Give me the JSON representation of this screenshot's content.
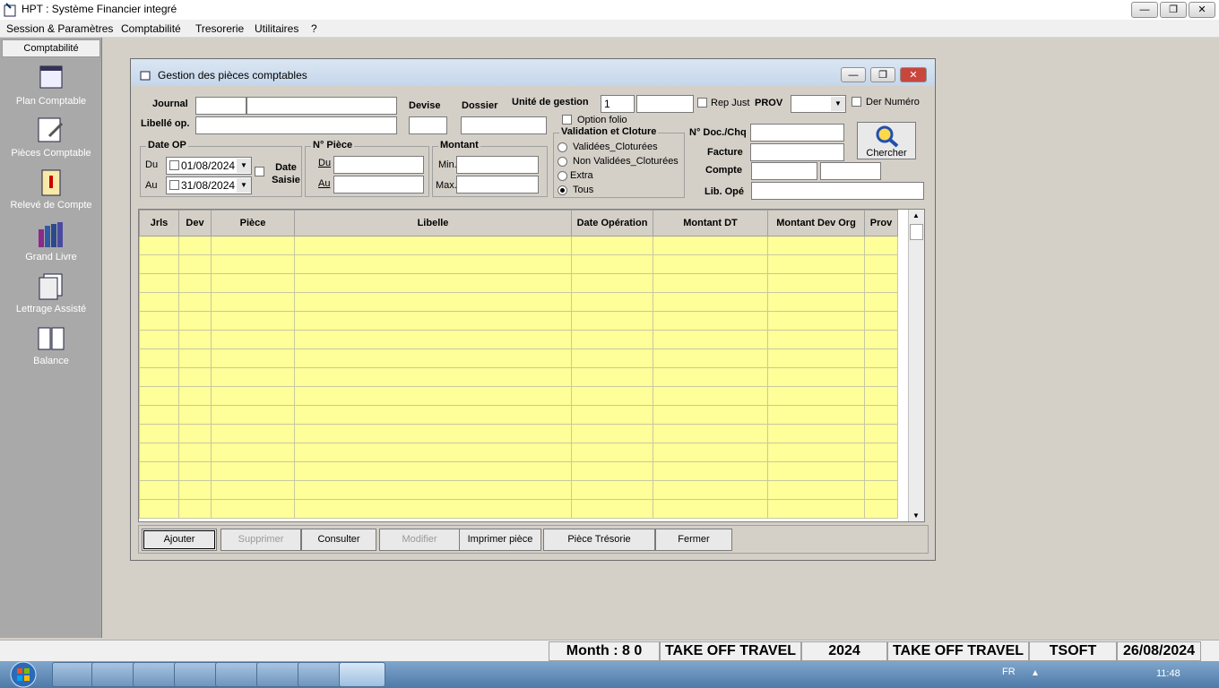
{
  "window": {
    "title": "HPT : Système  Financier integré"
  },
  "menu": [
    "Session & Paramètres",
    "Comptabilité",
    "Tresorerie",
    "Utilitaires",
    "?"
  ],
  "sidebar": {
    "header": "Comptabilité",
    "items": [
      "Plan Comptable",
      "Pièces Comptable",
      "Relevé de Compte",
      "Grand Livre",
      "Lettrage Assisté",
      "Balance"
    ]
  },
  "dialog": {
    "title": "Gestion des pièces comptables",
    "journal_label": "Journal",
    "libelle_label": "Libellé op.",
    "devise_label": "Devise",
    "dossier_label": "Dossier",
    "unite_label": "Unité de gestion",
    "unite_value": "1",
    "repjust_label": "Rep Just",
    "prov_label": "PROV",
    "dernumero_label": "Der Numéro",
    "option_folio": "Option folio",
    "dateop": {
      "title": "Date OP",
      "du": "Du",
      "au": "Au",
      "du_value": "01/08/2024",
      "au_value": "31/08/2024",
      "date_saisie": "Date Saisie"
    },
    "piece": {
      "title": "N° Pièce",
      "du": "Du",
      "au": "Au"
    },
    "montant": {
      "title": "Montant",
      "min": "Min.",
      "max": "Max."
    },
    "validation": {
      "title": "Validation et Cloture",
      "options": [
        "Validées_Cloturées",
        "Non Validées_Cloturées",
        "Extra",
        "Tous"
      ],
      "selected": "Tous"
    },
    "ndoc_label": "N° Doc./Chq",
    "facture_label": "Facture",
    "compte_label": "Compte",
    "libope_label": "Lib. Opé",
    "search_button": "Chercher",
    "columns": [
      "Jrls",
      "Dev",
      "Pièce",
      "Libelle",
      "Date Opération",
      "Montant DT",
      "Montant Dev Org",
      "Prov"
    ],
    "buttons": {
      "ajouter": "Ajouter",
      "supprimer": "Supprimer",
      "consulter": "Consulter",
      "modifier": "Modifier",
      "imprimer": "Imprimer pièce",
      "tresorie": "Pièce Trésorie",
      "fermer": "Fermer"
    }
  },
  "status": {
    "month": "Month : 8 0",
    "company1": "TAKE OFF TRAVEL",
    "year": "2024",
    "company2": "TAKE OFF TRAVEL",
    "user": "TSOFT",
    "date": "26/08/2024"
  },
  "taskbar": {
    "lang": "FR",
    "time": "11:48"
  },
  "colors": {
    "grid_row": "#ffff99",
    "sidebar": "#a9a9a9"
  }
}
